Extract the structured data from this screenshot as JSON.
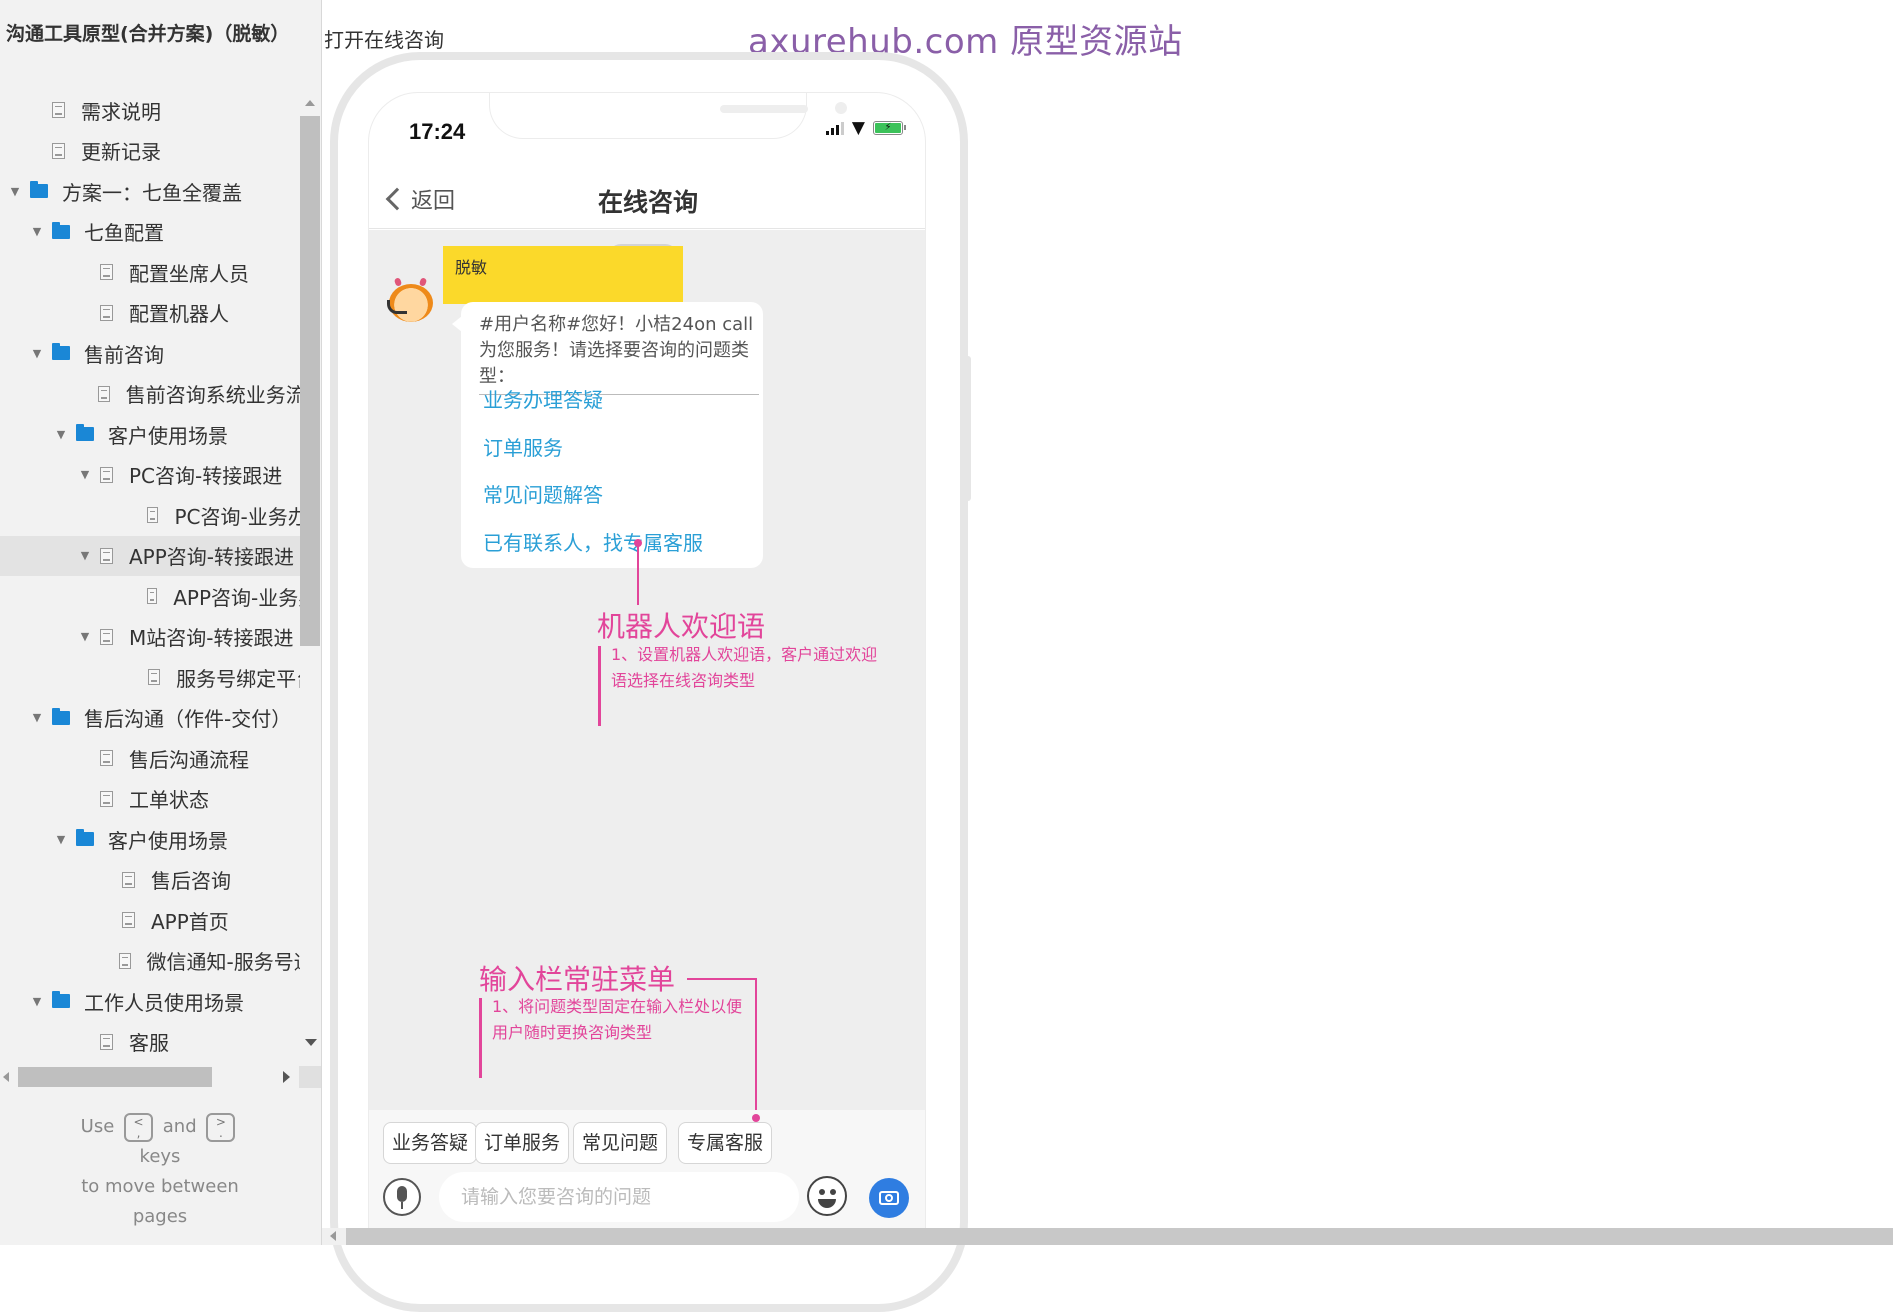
{
  "sidebar": {
    "project_title": "沟通工具原型(合并方案)（脱敏）",
    "items": [
      {
        "label": "需求说明",
        "type": "page",
        "level": 1,
        "expanded": null
      },
      {
        "label": "更新记录",
        "type": "page",
        "level": 1,
        "expanded": null
      },
      {
        "label": "方案一：七鱼全覆盖",
        "type": "folder",
        "level": 0,
        "expanded": true
      },
      {
        "label": "七鱼配置",
        "type": "folder",
        "level": 1,
        "expanded": true
      },
      {
        "label": "配置坐席人员",
        "type": "page",
        "level": 3,
        "expanded": null
      },
      {
        "label": "配置机器人",
        "type": "page",
        "level": 3,
        "expanded": null
      },
      {
        "label": "售前咨询",
        "type": "folder",
        "level": 1,
        "expanded": true
      },
      {
        "label": "售前咨询系统业务流程",
        "type": "page",
        "level": 3,
        "expanded": null
      },
      {
        "label": "客户使用场景",
        "type": "folder",
        "level": 2,
        "expanded": true
      },
      {
        "label": "PC咨询-转接跟进",
        "type": "page",
        "level": 3,
        "expanded": true
      },
      {
        "label": "PC咨询-业务办理",
        "type": "page",
        "level": 5,
        "expanded": null
      },
      {
        "label": "APP咨询-转接跟进",
        "type": "page",
        "level": 3,
        "expanded": true,
        "selected": true
      },
      {
        "label": "APP咨询-业务办理",
        "type": "page",
        "level": 5,
        "expanded": null
      },
      {
        "label": "M站咨询-转接跟进",
        "type": "page",
        "level": 3,
        "expanded": true
      },
      {
        "label": "服务号绑定平台",
        "type": "page",
        "level": 5,
        "expanded": null
      },
      {
        "label": "售后沟通（作件-交付）",
        "type": "folder",
        "level": 1,
        "expanded": true
      },
      {
        "label": "售后沟通流程",
        "type": "page",
        "level": 3,
        "expanded": null
      },
      {
        "label": "工单状态",
        "type": "page",
        "level": 3,
        "expanded": null
      },
      {
        "label": "客户使用场景",
        "type": "folder",
        "level": 2,
        "expanded": true
      },
      {
        "label": "售后咨询",
        "type": "page",
        "level": 4,
        "expanded": null
      },
      {
        "label": "APP首页",
        "type": "page",
        "level": 4,
        "expanded": null
      },
      {
        "label": "微信通知-服务号通知",
        "type": "page",
        "level": 4,
        "expanded": null
      },
      {
        "label": "工作人员使用场景",
        "type": "folder",
        "level": 1,
        "expanded": true
      },
      {
        "label": "客服",
        "type": "page",
        "level": 3,
        "expanded": null
      }
    ],
    "hint": {
      "use": "Use",
      "key_prev": "<\n,",
      "and": "and",
      "key_next": ">\n.",
      "line2": "keys",
      "line3": "to move between",
      "line4": "pages"
    }
  },
  "page": {
    "name": "打开在线咨询",
    "watermark": "axurehub.com 原型资源站"
  },
  "phone": {
    "status_time": "17:24",
    "status_icons": [
      "signal-icon",
      "wifi-icon",
      "battery-charging-icon"
    ],
    "nav": {
      "back_label": "返回",
      "title": "在线咨询"
    },
    "chat": {
      "masked_label": "脱敏",
      "greeting": "#用户名称#您好！小桔24on call为您服务！请选择要咨询的问题类型：",
      "options": [
        "业务办理答疑",
        "订单服务",
        "常见问题解答",
        "已有联系人，找专属客服"
      ]
    },
    "quick_menu": [
      "业务答疑",
      "订单服务",
      "常见问题",
      "专属客服"
    ],
    "input": {
      "placeholder": "请输入您要咨询的问题",
      "value": ""
    }
  },
  "annotations": [
    {
      "title": "机器人欢迎语",
      "body": "1、设置机器人欢迎语，客户通过欢迎语选择在线咨询类型"
    },
    {
      "title": "输入栏常驻菜单",
      "body": "1、将问题类型固定在输入栏处以便用户随时更换咨询类型"
    }
  ],
  "colors": {
    "annotation": "#e2459a",
    "link": "#2a9fd6",
    "watermark": "#8a5fa8",
    "mask": "#fbd92a",
    "folder": "#1a87d6",
    "camera_button": "#2f7de1"
  }
}
